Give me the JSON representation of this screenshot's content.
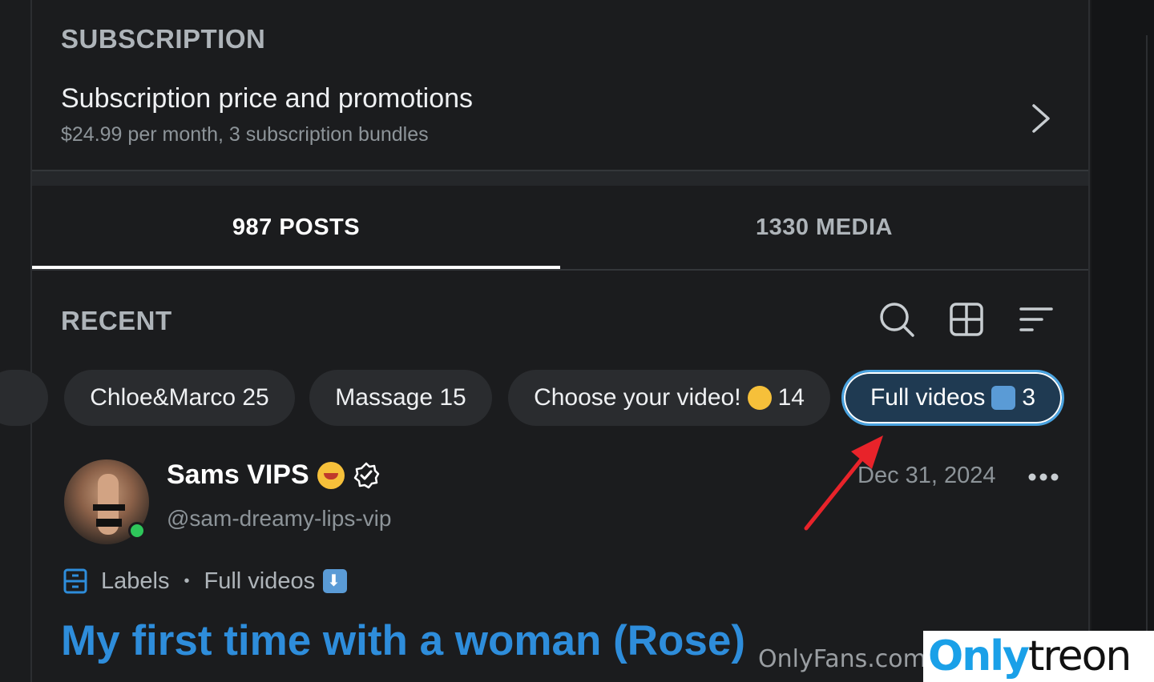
{
  "subscription": {
    "section_label": "SUBSCRIPTION",
    "title": "Subscription price and promotions",
    "detail": "$24.99 per month, 3 subscription bundles"
  },
  "tabs": [
    {
      "label": "987 POSTS",
      "active": true
    },
    {
      "label": "1330 MEDIA",
      "active": false
    }
  ],
  "recent": {
    "section_label": "RECENT",
    "icons": [
      "search-icon",
      "grid-icon",
      "sort-icon"
    ]
  },
  "chips": [
    {
      "label": "Chloe&Marco 25"
    },
    {
      "label": "Massage 15"
    },
    {
      "label": "Choose your video!",
      "emoji": "smiling-face-with-halo",
      "count": "14"
    },
    {
      "label": "Full videos",
      "emoji": "down-arrow-button",
      "count": "3",
      "selected": true
    }
  ],
  "post": {
    "author_name": "Sams VIPS",
    "author_emoji": "smiling-face-with-hearts",
    "handle": "@sam-dreamy-lips-vip",
    "date": "Dec 31, 2024",
    "labels_prefix": "Labels",
    "label_value": "Full videos",
    "title": "My first time with a woman (Rose)"
  },
  "watermark": {
    "small": "OnlyFans.com",
    "brand_a": "Only",
    "brand_b": "treon"
  },
  "colors": {
    "background": "#1b1c1e",
    "accent": "#2e8ddb",
    "selected_chip_border": "#4aa3e0",
    "online": "#2ec65a",
    "annotation_arrow": "#e8232a"
  }
}
